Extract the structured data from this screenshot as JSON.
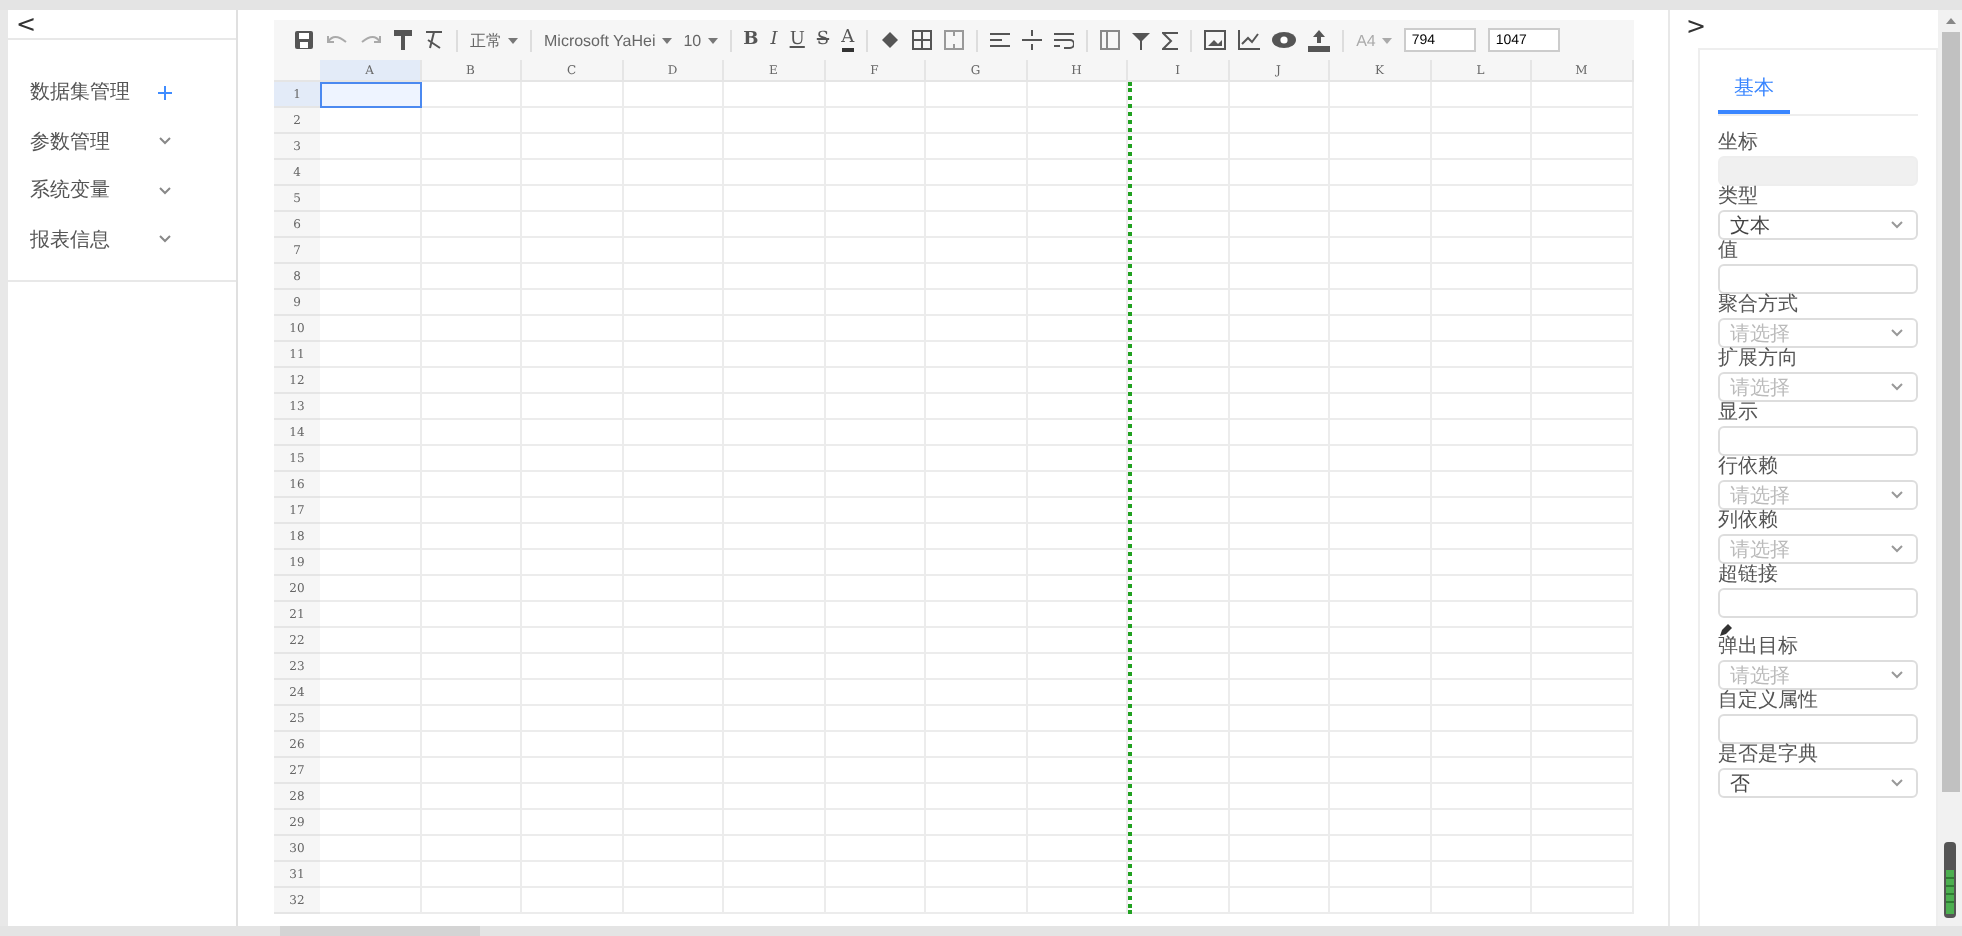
{
  "left_panel": {
    "collapse": "<",
    "items": [
      {
        "label": "数据集管理",
        "kind": "add"
      },
      {
        "label": "参数管理",
        "kind": "expand"
      },
      {
        "label": "系统变量",
        "kind": "expand"
      },
      {
        "label": "报表信息",
        "kind": "expand"
      }
    ]
  },
  "toolbar": {
    "style_dropdown": "正常",
    "font_dropdown": "Microsoft YaHei",
    "size_dropdown": "10",
    "format_buttons": [
      "B",
      "I",
      "U",
      "S",
      "A"
    ],
    "paper_dropdown": "A4",
    "width_input": "794",
    "height_input": "1047"
  },
  "sheet": {
    "columns": [
      {
        "label": "A",
        "selected": true,
        "page_break": false
      },
      {
        "label": "B",
        "selected": false,
        "page_break": false
      },
      {
        "label": "C",
        "selected": false,
        "page_break": false
      },
      {
        "label": "D",
        "selected": false,
        "page_break": false
      },
      {
        "label": "E",
        "selected": false,
        "page_break": false
      },
      {
        "label": "F",
        "selected": false,
        "page_break": false
      },
      {
        "label": "G",
        "selected": false,
        "page_break": false
      },
      {
        "label": "H",
        "selected": false,
        "page_break": true
      },
      {
        "label": "I",
        "selected": false,
        "page_break": false
      },
      {
        "label": "J",
        "selected": false,
        "page_break": false
      },
      {
        "label": "K",
        "selected": false,
        "page_break": false
      },
      {
        "label": "L",
        "selected": false,
        "page_break": false
      },
      {
        "label": "M",
        "selected": false,
        "page_break": false
      }
    ],
    "rows": [
      {
        "label": "1",
        "selected": true
      },
      {
        "label": "2",
        "selected": false
      },
      {
        "label": "3",
        "selected": false
      },
      {
        "label": "4",
        "selected": false
      },
      {
        "label": "5",
        "selected": false
      },
      {
        "label": "6",
        "selected": false
      },
      {
        "label": "7",
        "selected": false
      },
      {
        "label": "8",
        "selected": false
      },
      {
        "label": "9",
        "selected": false
      },
      {
        "label": "10",
        "selected": false
      },
      {
        "label": "11",
        "selected": false
      },
      {
        "label": "12",
        "selected": false
      },
      {
        "label": "13",
        "selected": false
      },
      {
        "label": "14",
        "selected": false
      },
      {
        "label": "15",
        "selected": false
      },
      {
        "label": "16",
        "selected": false
      },
      {
        "label": "17",
        "selected": false
      },
      {
        "label": "18",
        "selected": false
      },
      {
        "label": "19",
        "selected": false
      },
      {
        "label": "20",
        "selected": false
      },
      {
        "label": "21",
        "selected": false
      },
      {
        "label": "22",
        "selected": false
      },
      {
        "label": "23",
        "selected": false
      },
      {
        "label": "24",
        "selected": false
      },
      {
        "label": "25",
        "selected": false
      },
      {
        "label": "26",
        "selected": false
      },
      {
        "label": "27",
        "selected": false
      },
      {
        "label": "28",
        "selected": false
      },
      {
        "label": "29",
        "selected": false
      },
      {
        "label": "30",
        "selected": false
      },
      {
        "label": "31",
        "selected": false
      },
      {
        "label": "32",
        "selected": false
      }
    ]
  },
  "right_panel": {
    "collapse": ">",
    "tabs": [
      {
        "label": "基本",
        "selected": true
      }
    ],
    "fields": [
      {
        "label": "坐标",
        "kind": "disabled"
      },
      {
        "label": "类型",
        "kind": "select",
        "value": "文本"
      },
      {
        "label": "值",
        "kind": "input"
      },
      {
        "label": "聚合方式",
        "kind": "select",
        "placeholder": "请选择"
      },
      {
        "label": "扩展方向",
        "kind": "select",
        "placeholder": "请选择"
      },
      {
        "label": "显示",
        "kind": "input"
      },
      {
        "label": "行依赖",
        "kind": "select",
        "placeholder": "请选择"
      },
      {
        "label": "列依赖",
        "kind": "select",
        "placeholder": "请选择"
      },
      {
        "label": "超链接",
        "kind": "link"
      },
      {
        "label": "弹出目标",
        "kind": "select",
        "placeholder": "请选择"
      },
      {
        "label": "自定义属性",
        "kind": "input"
      },
      {
        "label": "是否是字典",
        "kind": "select",
        "value": "否"
      }
    ]
  }
}
